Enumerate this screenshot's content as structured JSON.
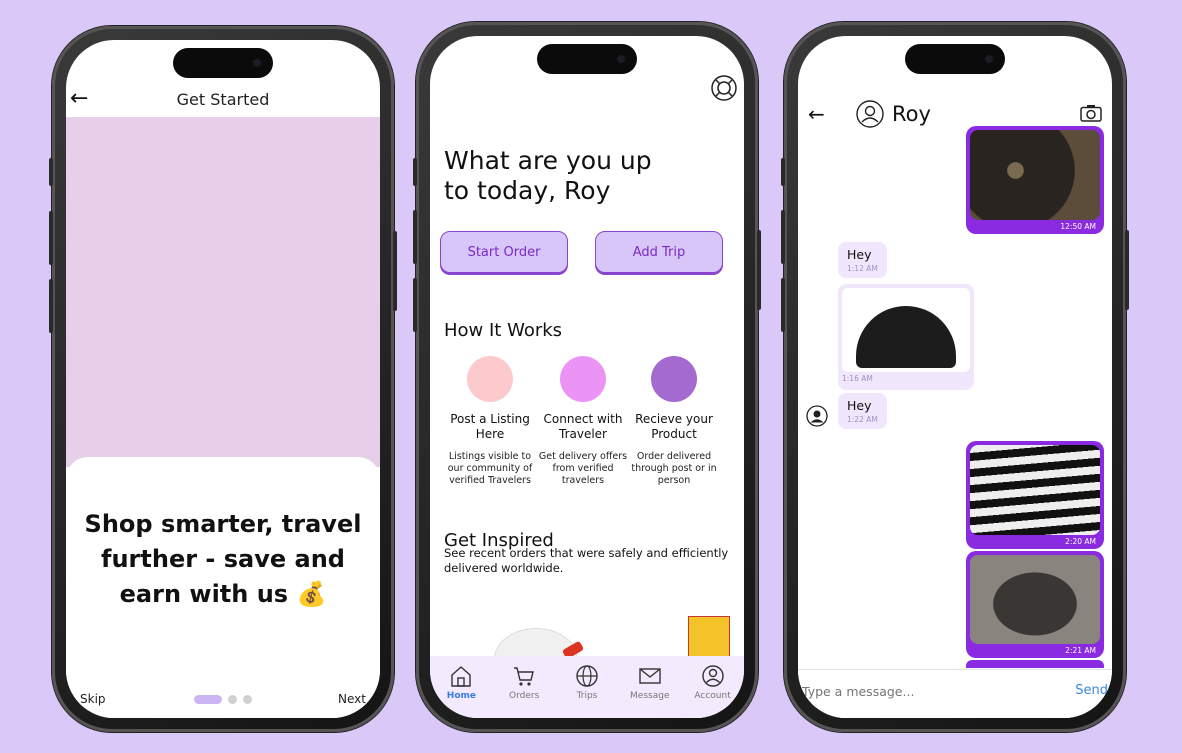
{
  "onboarding": {
    "header_title": "Get Started",
    "tagline": "Shop smarter, travel further - save and earn with us 💰",
    "skip_label": "Skip",
    "next_label": "Next",
    "page_count": 3,
    "active_page": 1,
    "hero_color": "#e7cfe9"
  },
  "home": {
    "greeting": "What are you up to today, Roy",
    "start_order_label": "Start Order",
    "add_trip_label": "Add Trip",
    "how_it_works_title": "How It Works",
    "steps": [
      {
        "title": "Post a Listing Here",
        "desc": "Listings visible to our community of verified Travelers",
        "color": "#fcc9cd"
      },
      {
        "title": "Connect with Traveler",
        "desc": "Get delivery offers from verified travelers",
        "color": "#ec94f5"
      },
      {
        "title": "Recieve your Product",
        "desc": "Order delivered through post or in person",
        "color": "#a46ad0"
      }
    ],
    "get_inspired_title": "Get Inspired",
    "get_inspired_desc": "See recent orders that were safely and efficiently delivered worldwide.",
    "nav": [
      {
        "label": "Home",
        "icon": "home-icon",
        "active": true
      },
      {
        "label": "Orders",
        "icon": "cart-icon",
        "active": false
      },
      {
        "label": "Trips",
        "icon": "globe-icon",
        "active": false
      },
      {
        "label": "Message",
        "icon": "mail-icon",
        "active": false
      },
      {
        "label": "Account",
        "icon": "user-icon",
        "active": false
      }
    ],
    "accent_color": "#8a45cf"
  },
  "chat": {
    "contact_name": "Roy",
    "messages": [
      {
        "type": "image",
        "side": "right",
        "time": "12:50 AM",
        "icon": "cat-photo"
      },
      {
        "type": "text",
        "side": "left",
        "text": "Hey",
        "time": "1:12 AM"
      },
      {
        "type": "image",
        "side": "left",
        "time": "1:16 AM",
        "icon": "beanie-photo"
      },
      {
        "type": "text",
        "side": "left",
        "text": "Hey",
        "time": "1:22 AM"
      },
      {
        "type": "image",
        "side": "right",
        "time": "2:20 AM",
        "icon": "knit-photo"
      },
      {
        "type": "image",
        "side": "right",
        "time": "2:21 AM",
        "icon": "backpack-photo"
      }
    ],
    "input_placeholder": "Type a message...",
    "send_label": "Send",
    "bubble_color": "#8a2be2"
  }
}
